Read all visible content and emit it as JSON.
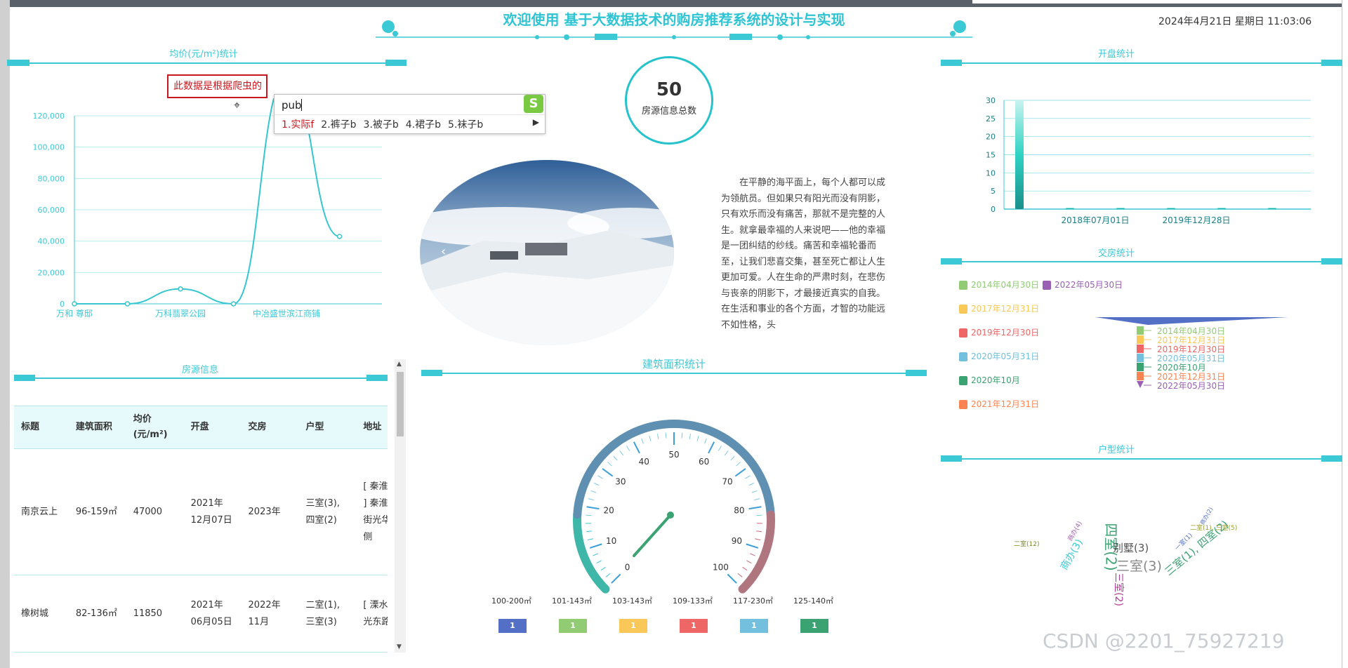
{
  "header": {
    "title": "欢迎使用 基于大数据技术的购房推荐系统的设计与实现",
    "datetime": "2024年4月21日 星期日 11:03:06"
  },
  "avg_price_panel": {
    "title": "均价(元/m²)统计",
    "annotation": "此数据是根据爬虫的"
  },
  "ime": {
    "typed": "pub",
    "candidates": [
      "1.实际f",
      "2.裤子b",
      "3.被子b",
      "4.裙子b",
      "5.袜子b"
    ],
    "logo": "S"
  },
  "center": {
    "total_value": "50",
    "total_label": "房源信息总数",
    "carousel_prev": "‹",
    "paragraph": "在平静的海平面上，每个人都可以成为领航员。但如果只有阳光而没有阴影，只有欢乐而没有痛苦，那就不是完整的人生。就拿最幸福的人来说吧——他的幸福是一团纠结的纱线。痛苦和幸福轮番而至，让我们悲喜交集，甚至死亡都让人生更加可爱。人在生命的严肃时刻，在悲伤与丧亲的阴影下，才最接近真实的自我。在生活和事业的各个方面，才智的功能远不如性格，头"
  },
  "house_info": {
    "title": "房源信息",
    "columns": [
      "标题",
      "建筑面积",
      "均价(元/m²)",
      "开盘",
      "交房",
      "户型",
      "地址"
    ],
    "rows": [
      [
        "南京云上",
        "96-159㎡",
        "47000",
        "2021年12月07日",
        "2023年",
        "三室(3), 四室(2)",
        "[ 秦淮 - 月牙湖 ] 秦淮区月牙湖街光华路鑫大厦侧"
      ],
      [
        "橡树城",
        "82-136㎡",
        "11850",
        "2021年06月05日",
        "2022年11月",
        "二室(1), 三室(3)",
        "[ 溧水 - 溧水 ] 光东路号"
      ]
    ]
  },
  "area_panel": {
    "title": "建筑面积统计",
    "ranges": [
      "100-200㎡",
      "101-143㎡",
      "103-143㎡",
      "109-133㎡",
      "117-230㎡",
      "125-140㎡"
    ],
    "counts": [
      "1",
      "1",
      "1",
      "1",
      "1",
      "1"
    ],
    "colors": [
      "#5470c6",
      "#91cc75",
      "#fac858",
      "#ee6666",
      "#73c0de",
      "#3ba272"
    ]
  },
  "opening_panel": {
    "title": "开盘统计"
  },
  "delivery_panel": {
    "title": "交房统计",
    "legend": [
      "2014年04月30日",
      "2022年05月30日",
      "2017年12月31日",
      "2019年12月30日",
      "2020年05月31日",
      "2020年10月",
      "2021年12月31日"
    ],
    "legend_colors": [
      "#91cc75",
      "#9a60b4",
      "#fac858",
      "#ee6666",
      "#73c0de",
      "#3ba272",
      "#fc8452"
    ],
    "funnel_labels": [
      "2014年04月30日",
      "2017年12月31日",
      "2019年12月30日",
      "2020年05月31日",
      "2020年10月",
      "2021年12月31日",
      "2022年05月30日"
    ],
    "funnel_colors": [
      "#91cc75",
      "#fac858",
      "#ee6666",
      "#73c0de",
      "#3ba272",
      "#fc8452",
      "#9a60b4"
    ]
  },
  "layout_panel": {
    "title": "户型统计",
    "words": [
      {
        "text": "四室(2)",
        "color": "#3ba272"
      },
      {
        "text": "别墅(3)",
        "color": "#555555"
      },
      {
        "text": "三室(3)",
        "color": "#888888"
      },
      {
        "text": "三室(1), 四室(2)",
        "color": "#3ba272"
      },
      {
        "text": "商办(3)",
        "color": "#3cc9d6"
      },
      {
        "text": "二室(12)",
        "color": "#7a8a2a"
      },
      {
        "text": "二室(1), 三室(5)",
        "color": "#9aa02a"
      },
      {
        "text": "三室(2)",
        "color": "#b03a9a"
      },
      {
        "text": "商办(4)",
        "color": "#a060b0"
      },
      {
        "text": "一室(1)",
        "color": "#5470c6"
      },
      {
        "text": "商办(2)",
        "color": "#5470c6"
      }
    ]
  },
  "watermark": "CSDN @2201_75927219",
  "chart_data": [
    {
      "type": "line",
      "title": "均价(元/m²)统计",
      "categories": [
        "万和 尊邸",
        "",
        "万科翡翠公园",
        "",
        "中冶盛世滨江商铺",
        ""
      ],
      "values": [
        0,
        0,
        9500,
        0,
        145000,
        43000
      ],
      "ylim": [
        0,
        120000
      ],
      "yticks": [
        "0",
        "20,000",
        "40,000",
        "60,000",
        "80,000",
        "100,000",
        "120,000"
      ],
      "color": "#36c6cf"
    },
    {
      "type": "bar",
      "title": "开盘统计",
      "categories": [
        "",
        "",
        "",
        "",
        "",
        ""
      ],
      "xtick_labels": [
        "2018年07月01日",
        "2019年12月28日"
      ],
      "values": [
        30,
        0.3,
        0.3,
        0.3,
        0.3,
        0.3
      ],
      "ylim": [
        0,
        30
      ],
      "yticks": [
        "0",
        "5",
        "10",
        "15",
        "20",
        "25",
        "30"
      ]
    },
    {
      "type": "gauge",
      "title": "建筑面积统计",
      "min": 0,
      "max": 100,
      "value": 50,
      "ticks": [
        "0",
        "10",
        "20",
        "30",
        "40",
        "50",
        "60",
        "70",
        "80",
        "90",
        "100"
      ]
    }
  ]
}
